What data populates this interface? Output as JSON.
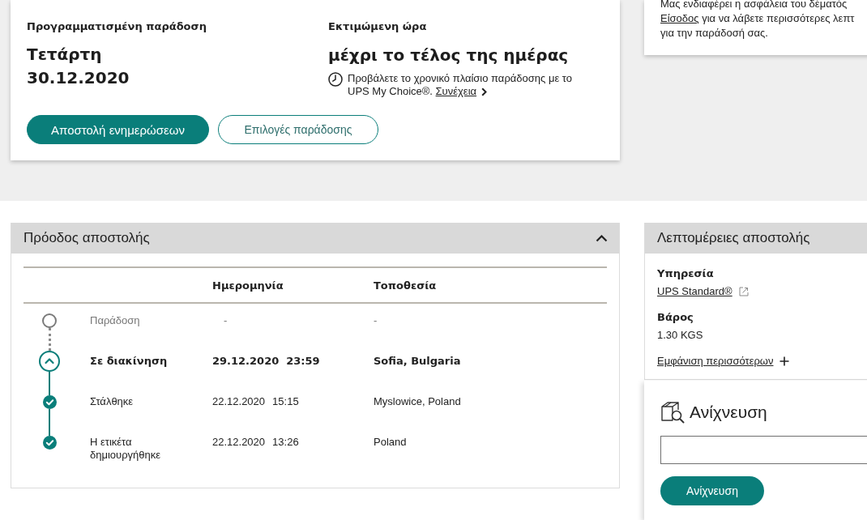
{
  "delivery_card": {
    "scheduled_label": "Προγραμματισμένη παράδοση",
    "day": "Τετάρτη",
    "date": "30.12.2020",
    "estimate_label": "Εκτιμώμενη ώρα",
    "estimate": "μέχρι το τέλος της ημέρας",
    "note": "Προβάλετε το χρονικό πλαίσιο παράδοσης με το UPS My Choice®.",
    "note_link": "Συνέχεια",
    "buttons": [
      {
        "label": "Αποστολή ενημερώσεων",
        "kind": "primary"
      },
      {
        "label": "Επιλογές παράδοσης",
        "kind": "secondary"
      }
    ]
  },
  "notice_card": {
    "line_1": "Μας ενδιαφέρει η ασφάλεια του δέματός",
    "link": "Είσοδος",
    "line_2": "για να λάβετε περισσότερες λεπτ",
    "line_3": "για την παράδοσή σας."
  },
  "progress_panel": {
    "title": "Πρόοδος αποστολής",
    "expanded": true,
    "columns": [
      "Ημερομηνία",
      "Τοποθεσία"
    ],
    "rows": [
      {
        "kind": "pending",
        "status": "Παράδοση",
        "date": "-",
        "location": "-"
      },
      {
        "kind": "current",
        "status": "Σε διακίνηση",
        "date": "29.12.2020",
        "time": "23:59",
        "location": "Sofia, Bulgaria"
      },
      {
        "kind": "done",
        "status": "Στάλθηκε",
        "date": "22.12.2020",
        "time": "15:15",
        "location": "Myslowice, Poland"
      },
      {
        "kind": "done",
        "status": "Η ετικέτα δημιουργήθηκε",
        "date": "22.12.2020",
        "time": "13:26",
        "location": "Poland"
      }
    ]
  },
  "details_panel": {
    "title": "Λεπτομέρειες αποστολής",
    "fields": [
      {
        "label": "Υπηρεσία",
        "value": "UPS Standard®",
        "kind": "link"
      },
      {
        "label": "Βάρος",
        "value": "1.30 KGS",
        "kind": "text"
      }
    ],
    "more_link": "Εμφάνιση περισσότερων"
  },
  "tracking_card": {
    "title": "Ανίχνευση",
    "button": "Ανίχνευση"
  }
}
